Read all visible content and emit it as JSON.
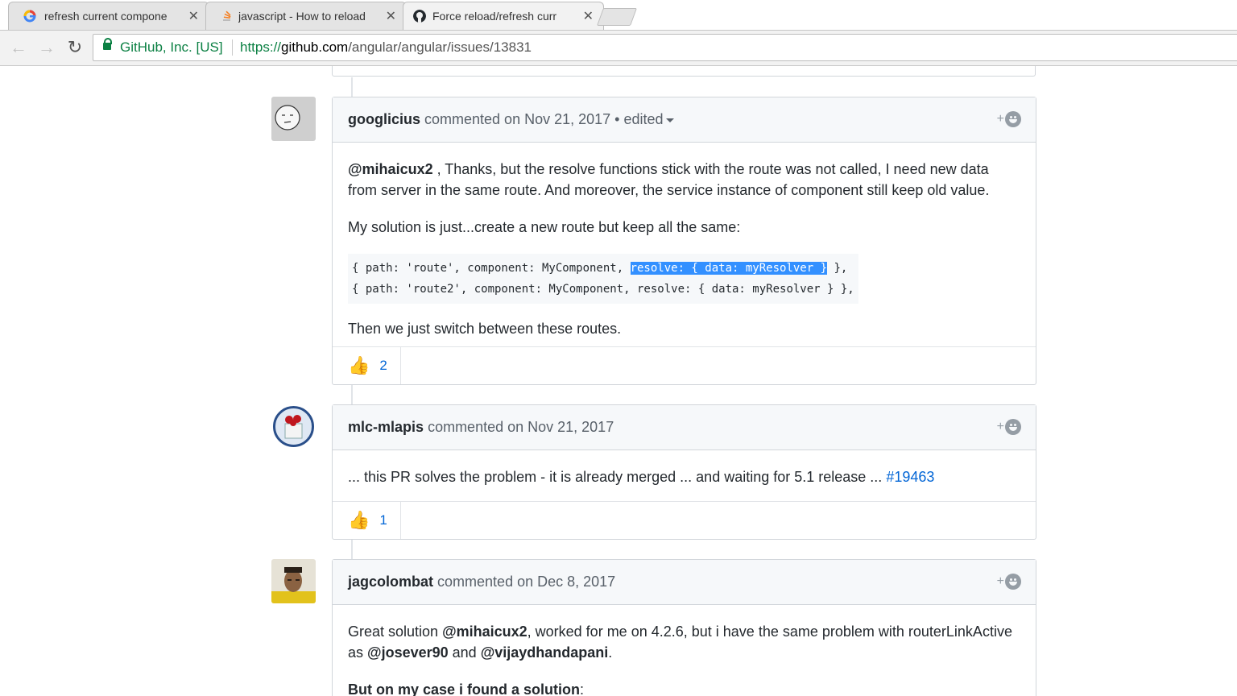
{
  "browser": {
    "tabs": [
      {
        "title": "refresh current compone",
        "favicon": "google-icon"
      },
      {
        "title": "javascript - How to reload",
        "favicon": "stackoverflow-icon"
      },
      {
        "title": "Force reload/refresh curr",
        "favicon": "github-icon",
        "active": true
      }
    ],
    "close_glyph": "✕",
    "origin": "GitHub, Inc. [US]",
    "url_scheme": "https://",
    "url_host": "github.com",
    "url_path": "/angular/angular/issues/13831"
  },
  "comments": [
    {
      "author": "googlicius",
      "meta": "commented on Nov 21, 2017 •",
      "edited": "edited",
      "paragraph1_mention": "@mihaicux2",
      "paragraph1_text": " , Thanks, but the resolve functions stick with the route was not called, I need new data from server in the same route. And moreover, the service instance of component still keep old value.",
      "paragraph2": "My solution is just...create a new route but keep all the same:",
      "code_line1_pre": "{ path: 'route', component: MyComponent, ",
      "code_line1_selected": "resolve: { data: myResolver }",
      "code_line1_post": " },",
      "code_line2": "{ path: 'route2', component: MyComponent, resolve: { data: myResolver } },",
      "paragraph3": "Then we just switch between these routes.",
      "reaction_count": "2",
      "add_reaction": "+"
    },
    {
      "author": "mlc-mlapis",
      "meta": "commented on Nov 21, 2017",
      "text": "... this PR solves the problem - it is already merged ... and waiting for 5.1 release ... ",
      "pr_link": "#19463",
      "reaction_count": "1",
      "add_reaction": "+"
    },
    {
      "author": "jagcolombat",
      "meta": "commented on Dec 8, 2017",
      "text_a": "Great solution ",
      "mention1": "@mihaicux2",
      "text_b": ", worked for me on 4.2.6, but i have the same problem with routerLinkActive as ",
      "mention2": "@josever90",
      "text_c": " and ",
      "mention3": "@vijaydhandapani",
      "text_d": ".",
      "bold_line": "But on my case i found a solution",
      "bold_line_suffix": ":",
      "add_reaction": "+"
    }
  ],
  "colors": {
    "link": "#0366d6",
    "selection": "#3390ff",
    "secure": "#0b8043"
  }
}
